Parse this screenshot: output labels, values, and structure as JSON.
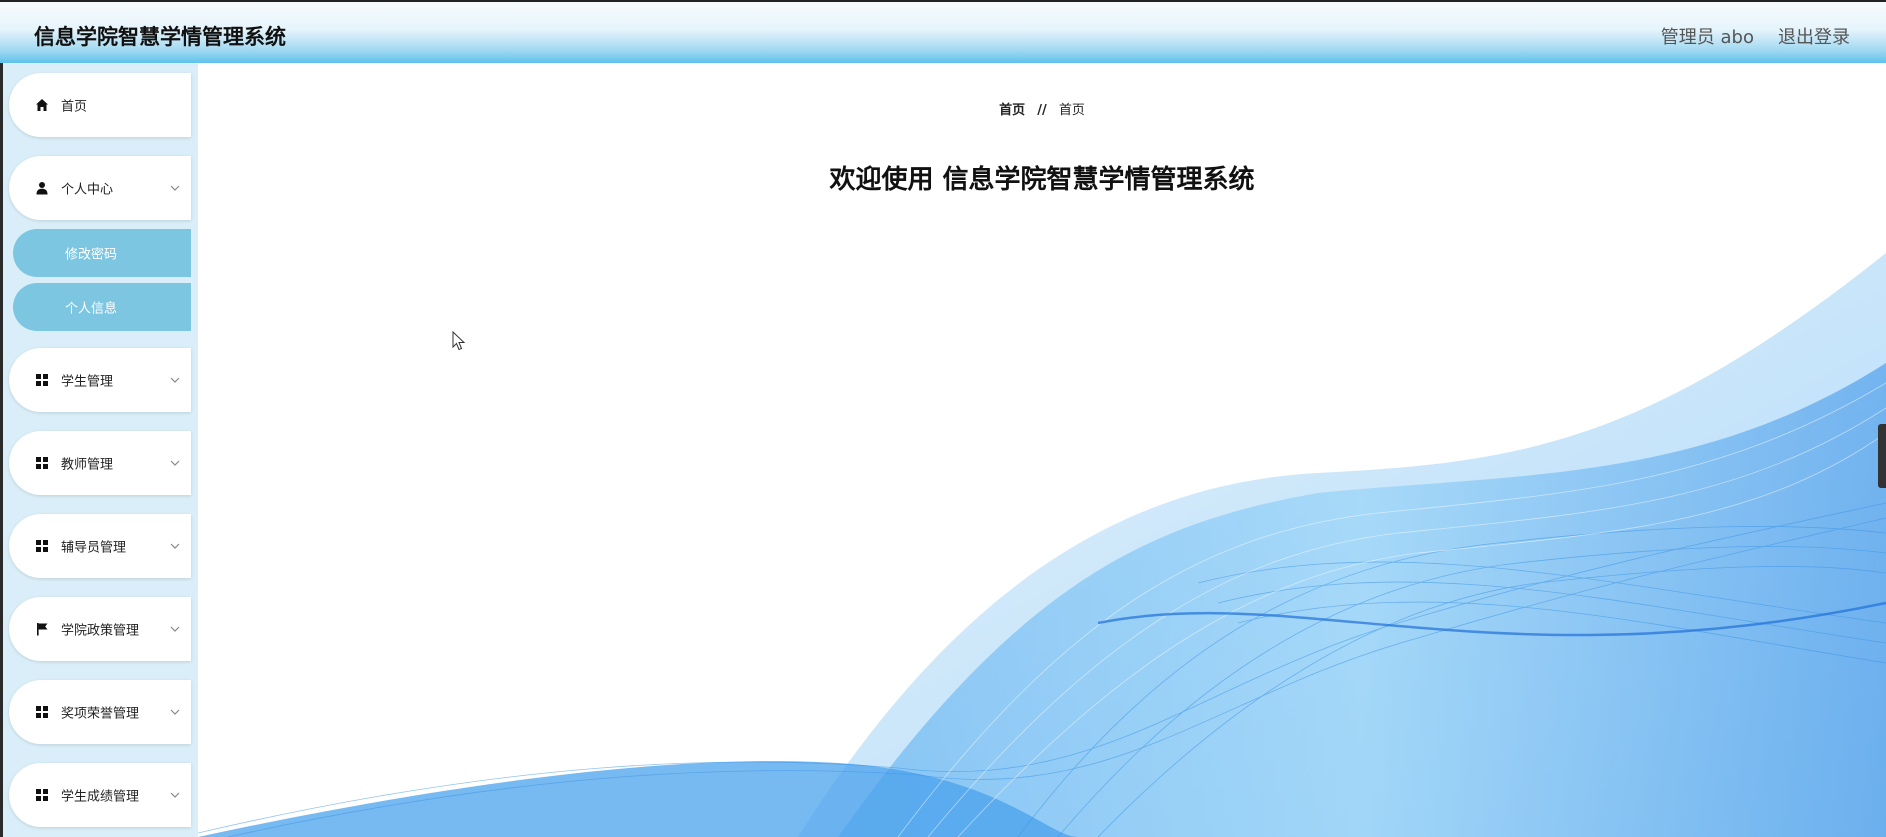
{
  "header": {
    "title": "信息学院智慧学情管理系统",
    "user_label": "管理员 abo",
    "logout_label": "退出登录"
  },
  "sidebar": {
    "items": [
      {
        "label": "首页",
        "icon": "home-icon"
      },
      {
        "label": "个人中心",
        "icon": "user-icon",
        "expanded": true,
        "children": [
          {
            "label": "修改密码"
          },
          {
            "label": "个人信息"
          }
        ]
      },
      {
        "label": "学生管理",
        "icon": "grid-icon"
      },
      {
        "label": "教师管理",
        "icon": "grid-icon"
      },
      {
        "label": "辅导员管理",
        "icon": "grid-icon"
      },
      {
        "label": "学院政策管理",
        "icon": "flag-icon"
      },
      {
        "label": "奖项荣誉管理",
        "icon": "grid-icon"
      },
      {
        "label": "学生成绩管理",
        "icon": "grid-icon"
      }
    ]
  },
  "breadcrumb": {
    "home": "首页",
    "separator": "//",
    "current": "首页"
  },
  "main": {
    "welcome": "欢迎使用 信息学院智慧学情管理系统"
  },
  "colors": {
    "accent": "#5ec2ec",
    "submenu_bg": "#7cc6e2",
    "sidebar_bg": "#d9eef8",
    "wave_blue": "#2f8ee6"
  }
}
